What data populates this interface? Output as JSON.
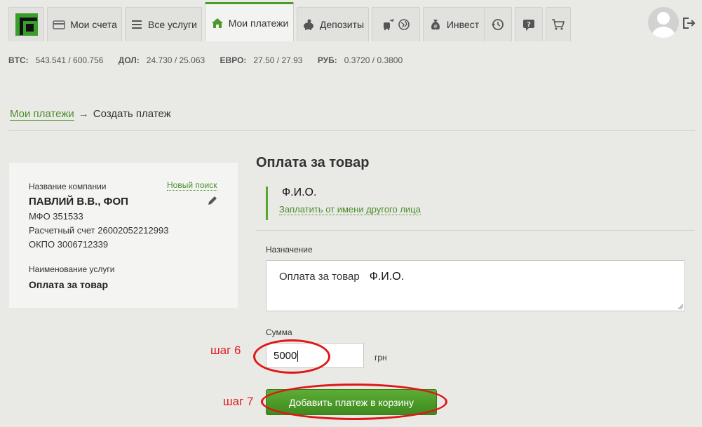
{
  "nav": {
    "tabs": [
      {
        "label": "",
        "icon": "privatbank-logo-icon"
      },
      {
        "label": "Мои счета",
        "icon": "card-icon"
      },
      {
        "label": "Все услуги",
        "icon": "list-icon"
      },
      {
        "label": "Мои платежи",
        "icon": "home-icon",
        "active": true
      },
      {
        "label": "Депозиты",
        "icon": "piggy-bank-icon"
      },
      {
        "label": "",
        "icon": "travel-icon"
      },
      {
        "label": "",
        "icon": "globe-icon"
      },
      {
        "label": "Инвест",
        "icon": "money-bag-icon"
      },
      {
        "label": "",
        "icon": "history-icon"
      },
      {
        "label": "",
        "icon": "help-icon"
      },
      {
        "label": "",
        "icon": "cart-icon"
      }
    ],
    "accent": "#4a9b2a"
  },
  "rates": [
    {
      "code": "BTC:",
      "value": "543.541 / 600.756"
    },
    {
      "code": "ДОЛ:",
      "value": "24.730 / 25.063"
    },
    {
      "code": "ЕВРО:",
      "value": "27.50 / 27.93"
    },
    {
      "code": "РУБ:",
      "value": "0.3720 / 0.3800"
    }
  ],
  "breadcrumb": {
    "parent": "Мои платежи",
    "arrow": "→",
    "current": "Создать платеж"
  },
  "recipient": {
    "company_label": "Название компании",
    "new_search": "Новый поиск",
    "company_name": "ПАВЛИЙ В.В., ФОП",
    "mfo": "МФО 351533",
    "account": "Расчетный счет 26002052212993",
    "okpo": "ОКПО 3006712339",
    "service_label": "Наименование услуги",
    "service_name": "Оплата за товар"
  },
  "form": {
    "title": "Оплата за товар",
    "payer_name": "Ф.И.О.",
    "pay_for_other": "Заплатить от имени другого лица",
    "purpose_label": "Назначение",
    "purpose_text": "Оплата за товар",
    "purpose_name": "Ф.И.О.",
    "amount_label": "Сумма",
    "amount_value": "5000",
    "currency": "грн",
    "submit": "Добавить платеж в корзину"
  },
  "annotations": {
    "step6": "шаг 6",
    "step7": "шаг 7",
    "color": "#e01515"
  }
}
